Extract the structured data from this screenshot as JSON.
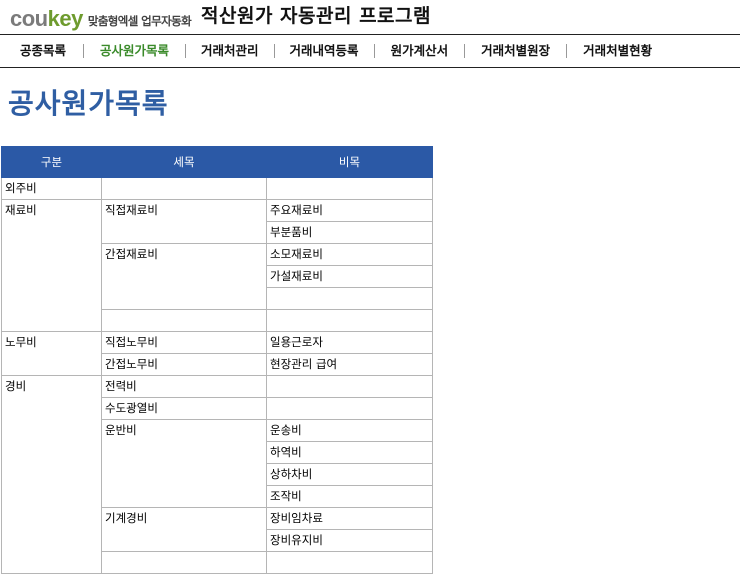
{
  "header": {
    "logo_prefix": "cou",
    "logo_accent": "key",
    "logo_tagline": "맞춤형엑셀 업무자동화",
    "app_title": "적산원가 자동관리 프로그램"
  },
  "nav": {
    "items": [
      {
        "label": "공종목록",
        "active": false
      },
      {
        "label": "공사원가목록",
        "active": true
      },
      {
        "label": "거래처관리",
        "active": false
      },
      {
        "label": "거래내역등록",
        "active": false
      },
      {
        "label": "원가계산서",
        "active": false
      },
      {
        "label": "거래처별원장",
        "active": false
      },
      {
        "label": "거래처별현황",
        "active": false
      }
    ]
  },
  "page": {
    "title": "공사원가목록"
  },
  "table": {
    "headers": [
      "구분",
      "세목",
      "비목"
    ],
    "rows": [
      {
        "cat": "외주비",
        "catSpan": 1,
        "sub": "",
        "subSpan": 1,
        "item": ""
      },
      {
        "cat": "재료비",
        "catSpan": 6,
        "sub": "직접재료비",
        "subSpan": 2,
        "item": "주요재료비"
      },
      {
        "item": "부분품비"
      },
      {
        "sub": "간접재료비",
        "subSpan": 3,
        "item": "소모재료비"
      },
      {
        "item": "가설재료비"
      },
      {
        "item": ""
      },
      {
        "sub": "",
        "subSpan": 1,
        "item": ""
      },
      {
        "cat": "노무비",
        "catSpan": 2,
        "sub": "직접노무비",
        "subSpan": 1,
        "item": "일용근로자"
      },
      {
        "sub": "간접노무비",
        "subSpan": 1,
        "item": "현장관리 급여"
      },
      {
        "cat": "경비",
        "catSpan": 9,
        "sub": "전력비",
        "subSpan": 1,
        "item": ""
      },
      {
        "sub": "수도광열비",
        "subSpan": 1,
        "item": ""
      },
      {
        "sub": "운반비",
        "subSpan": 4,
        "item": "운송비"
      },
      {
        "item": "하역비"
      },
      {
        "item": "상하차비"
      },
      {
        "item": "조작비"
      },
      {
        "sub": "기계경비",
        "subSpan": 2,
        "item": "장비임차료"
      },
      {
        "item": "장비유지비"
      },
      {
        "sub": "",
        "subSpan": 1,
        "item": ""
      }
    ]
  }
}
